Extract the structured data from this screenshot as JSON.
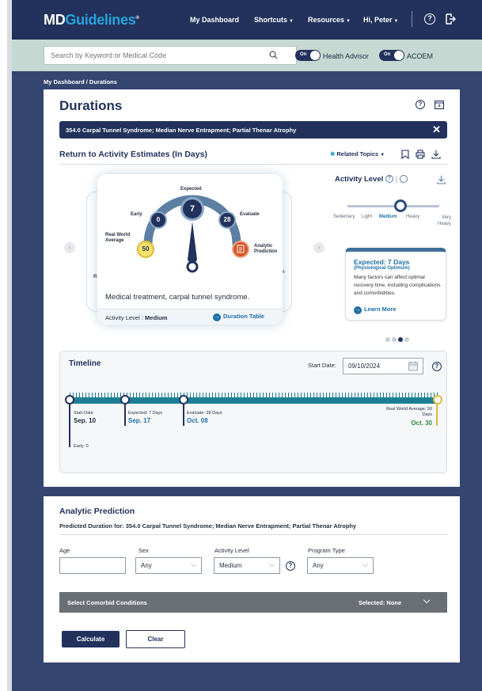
{
  "brand": {
    "md": "MD",
    "guidelines": "Guidelines",
    "mark": "®"
  },
  "nav": {
    "dashboard": "My Dashboard",
    "shortcuts": "Shortcuts",
    "resources": "Resources",
    "user": "Hi, Peter",
    "help": "?"
  },
  "search": {
    "placeholder": "Search by Keyword or Medical Code"
  },
  "toggles": [
    {
      "state": "On",
      "label": "Health Advisor"
    },
    {
      "state": "On",
      "label": "ACOEM"
    }
  ],
  "breadcrumb": "My Dashboard / Durations",
  "page": {
    "title": "Durations",
    "help": "?"
  },
  "banner": {
    "text": "354.0 Carpal Tunnel Syndrome; Median Nerve Entrapment; Partial Thenar Atrophy",
    "close": "✕"
  },
  "estimates": {
    "title": "Return to Activity Estimates (In Days)",
    "related": "Related Topics"
  },
  "gauge": {
    "expected_label": "Expected",
    "expected_value": "7",
    "early_label": "Early",
    "early_value": "0",
    "evaluate_label": "Evaluate",
    "evaluate_value": "28",
    "rwa_label": "Real World Average",
    "rwa_value": "50",
    "analytic_label": "Analytic Prediction",
    "caption": "Medical treatment, carpal tunnel syndrome.",
    "activity_label": "Activity Level : ",
    "activity_value": "Medium",
    "duration_table": "Duration Table",
    "back_left_text": "Re A",
    "back_right_text": "n"
  },
  "activity": {
    "title": "Activity Level",
    "levels": [
      "Sedentary",
      "Light",
      "Medium",
      "Heavy",
      "Very Heavy"
    ],
    "selected": "Medium",
    "info_title": "Expected: 7 Days",
    "info_sub": "(Physiological Optimum)",
    "info_body": "Many factors can affect optimal recovery time, including complications and comorbidities.",
    "learn_more": "Learn More"
  },
  "timeline": {
    "title": "Timeline",
    "start_label": "Start Date:",
    "start_value": "09/10/2024",
    "points": {
      "start_small": "Start Date",
      "start_date": "Sep. 10",
      "expected_small": "Expected: 7 Days",
      "expected_date": "Sep. 17",
      "evaluate_small": "Evaluate: 28 Days",
      "evaluate_date": "Oct. 08",
      "rwa_small": "Real World Average: 50 Days",
      "rwa_date": "Oct. 30",
      "early_small": "Early: 0"
    }
  },
  "analytic": {
    "title": "Analytic Prediction",
    "subtitle": "Predicted Duration for: 354.0 Carpal Tunnel Syndrome; Median Nerve Entrapment; Partial Thenar Atrophy",
    "age_label": "Age",
    "age_value": "",
    "sex_label": "Sex",
    "sex_value": "Any",
    "activity_label": "Activity Level",
    "activity_value": "Medium",
    "program_label": "Program Type",
    "program_value": "Any",
    "comorbid_label": "Select Comorbid Conditions",
    "comorbid_selected": "Selected: None",
    "calculate": "Calculate",
    "clear": "Clear"
  },
  "colors": {
    "navy": "#22325c",
    "frame": "#34456f",
    "accent": "#27a3dd",
    "teal": "#1b7e94",
    "searchbar": "#c5d8d2"
  }
}
